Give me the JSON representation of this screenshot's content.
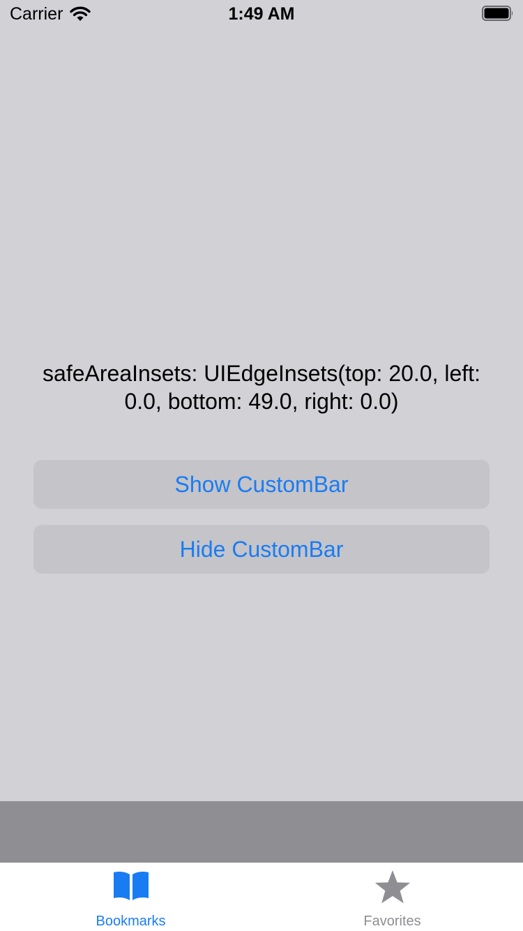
{
  "status_bar": {
    "carrier": "Carrier",
    "time": "1:49 AM"
  },
  "main": {
    "info_text": "safeAreaInsets: UIEdgeInsets(top: 20.0, left: 0.0, bottom: 49.0, right: 0.0)",
    "show_button": "Show CustomBar",
    "hide_button": "Hide CustomBar"
  },
  "tab_bar": {
    "items": [
      {
        "label": "Bookmarks",
        "icon": "book-icon",
        "selected": true
      },
      {
        "label": "Favorites",
        "icon": "star-icon",
        "selected": false
      }
    ]
  },
  "colors": {
    "accent": "#1a7cf2",
    "background": "#d1d1d6",
    "button_bg": "#c4c4c9",
    "custom_bar": "#8e8e93",
    "inactive_tab": "#8e8e93"
  }
}
